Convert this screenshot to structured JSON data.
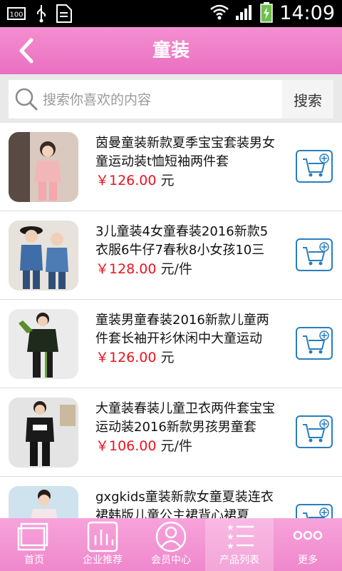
{
  "status_bar": {
    "battery_percent": "100",
    "time": "14:09"
  },
  "header": {
    "title": "童装"
  },
  "search": {
    "placeholder": "搜索你喜欢的内容",
    "button_label": "搜索"
  },
  "products": [
    {
      "name": "茵曼童装新款夏季宝宝套装男女童运动装t恤短袖两件套",
      "price": "￥126.00",
      "unit": "元"
    },
    {
      "name": "3儿童装4女童春装2016新款5衣服6牛仔7春秋8小女孩10三",
      "price": "￥128.00",
      "unit": "元/件"
    },
    {
      "name": "童装男童春装2016新款儿童两件套长袖开衫休闲中大童运动",
      "price": "￥126.00",
      "unit": "元"
    },
    {
      "name": "大童装春装儿童卫衣两件套宝宝运动装2016新款男孩男童套",
      "price": "￥106.00",
      "unit": "元/件"
    },
    {
      "name": "gxgkids童装新款女童夏装连衣裙韩版儿童公主裙背心裙夏",
      "price": "",
      "unit": ""
    }
  ],
  "tabbar": {
    "tabs": [
      {
        "label": "首页",
        "icon": "window-icon"
      },
      {
        "label": "企业推荐",
        "icon": "bar-chart-icon"
      },
      {
        "label": "会员中心",
        "icon": "user-icon"
      },
      {
        "label": "产品列表",
        "icon": "star-list-icon",
        "active": true
      },
      {
        "label": "更多",
        "icon": "more-dots-icon"
      }
    ]
  },
  "colors": {
    "header_pink": "#e96fc1",
    "tab_pink": "#f7a3db",
    "price_red": "#e8141c",
    "cart_blue": "#2a7ebd"
  }
}
